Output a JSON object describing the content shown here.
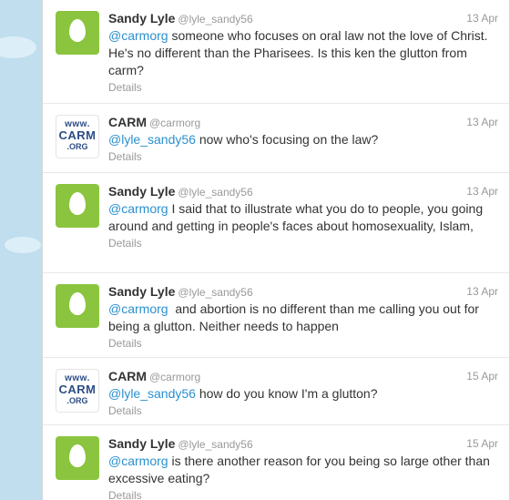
{
  "tweets": [
    {
      "fullname": "Sandy Lyle",
      "username": "@lyle_sandy56",
      "time": "13 Apr",
      "mention": "@carmorg",
      "text": " someone who focuses on oral law not the love of Christ. He's no different than the Pharisees. Is this ken the glutton from carm?",
      "details": "Details",
      "avatar": "egg"
    },
    {
      "fullname": "CARM",
      "username": "@carmorg",
      "time": "13 Apr",
      "mention": "@lyle_sandy56",
      "text": " now who's focusing on the law?",
      "details": "Details",
      "avatar": "carm"
    },
    {
      "fullname": "Sandy Lyle",
      "username": "@lyle_sandy56",
      "time": "13 Apr",
      "mention": "@carmorg",
      "text": " I said that to illustrate what you do to people, you going around and getting in people's faces about homosexuality, Islam,",
      "details": "Details",
      "avatar": "egg"
    },
    {
      "fullname": "Sandy Lyle",
      "username": "@lyle_sandy56",
      "time": "13 Apr",
      "mention": "@carmorg",
      "text": "  and abortion is no different than me calling you out for being a glutton. Neither needs to happen",
      "details": "Details",
      "avatar": "egg"
    },
    {
      "fullname": "CARM",
      "username": "@carmorg",
      "time": "15 Apr",
      "mention": "@lyle_sandy56",
      "text": " how do you know I'm a glutton?",
      "details": "Details",
      "avatar": "carm"
    },
    {
      "fullname": "Sandy Lyle",
      "username": "@lyle_sandy56",
      "time": "15 Apr",
      "mention": "@carmorg",
      "text": " is there another reason for you being so large other than excessive eating?",
      "details": "Details",
      "avatar": "egg"
    }
  ],
  "carm_logo": {
    "line1": "www.",
    "line2": "CARM",
    "line3": ".ORG"
  },
  "colors": {
    "link": "#2a90cf",
    "egg_green": "#8bc53f",
    "background": "#c0deed",
    "carm_blue": "#2d4d86"
  }
}
